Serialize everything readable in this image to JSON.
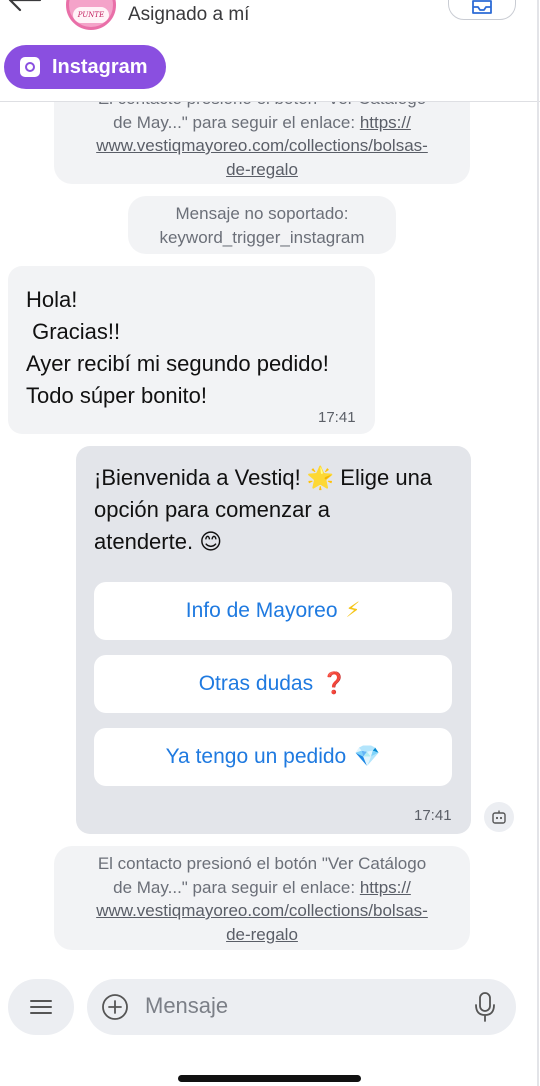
{
  "header": {
    "avatar_text": "PUNTE ROOM",
    "assigned_label": "Asignado a mí",
    "channel_chip_label": "Instagram"
  },
  "messages": {
    "system_note_top": {
      "line1": "El contacto presionó el botón \"Ver Catálogo",
      "line2": "de May...\" para seguir el enlace: ",
      "link_part1": "https://",
      "link_part2": "www.vestiqmayoreo.com/collections/bolsas-",
      "link_part3": "de-regalo"
    },
    "unsupported_note": {
      "line1": "Mensaje no soportado:",
      "line2": "keyword_trigger_instagram"
    },
    "incoming": {
      "line1": "Hola!",
      "line2": " Gracias!!",
      "line3": "Ayer recibí mi segundo pedido!",
      "line4": "Todo súper bonito!",
      "time": "17:41"
    },
    "bot": {
      "line1": "¡Bienvenida a Vestiq! 🌟 Elige una",
      "line2": "opción para comenzar a",
      "line3": "atenderte. 😊",
      "buttons": [
        {
          "label": "Info de Mayoreo",
          "emoji": "⚡"
        },
        {
          "label": "Otras dudas",
          "emoji": "❓"
        },
        {
          "label": "Ya tengo un pedido",
          "emoji": "💎"
        }
      ],
      "time": "17:41"
    },
    "system_note_bottom": {
      "line1": "El contacto presionó el botón \"Ver Catálogo",
      "line2": "de May...\" para seguir el enlace: ",
      "link_part1": "https://",
      "link_part2": "www.vestiqmayoreo.com/collections/bolsas-",
      "link_part3": "de-regalo"
    }
  },
  "composer": {
    "placeholder": "Mensaje"
  },
  "icons": {
    "back": "arrow-left-icon",
    "inbox": "inbox-icon",
    "channel": "instagram-icon",
    "bot": "bot-icon",
    "menu": "menu-icon",
    "add": "plus-circle-icon",
    "mic": "microphone-icon"
  },
  "colors": {
    "chip_purple": "#8a4fe0",
    "link_blue": "#1f7ae0",
    "bubble_gray": "#f2f3f5",
    "bot_bubble": "#e3e5ea"
  }
}
